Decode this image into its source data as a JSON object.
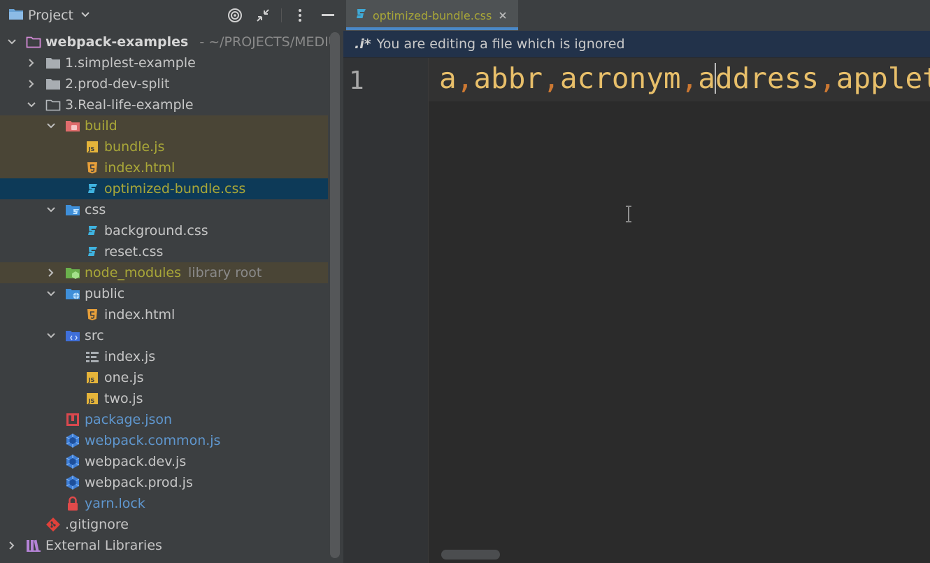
{
  "project_panel": {
    "title": "Project",
    "toolbar_icons": [
      "locate-icon",
      "collapse-icon",
      "more-icon",
      "hide-icon"
    ]
  },
  "tree": [
    {
      "label": "webpack-examples",
      "hint": "- ~/PROJECTS/MEDIU",
      "icon": "module-folder-icon",
      "expanded": true,
      "style": "bold"
    },
    {
      "label": "1.simplest-example",
      "icon": "folder-icon",
      "expanded": false,
      "style": "default"
    },
    {
      "label": "2.prod-dev-split",
      "icon": "folder-icon",
      "expanded": false,
      "style": "default"
    },
    {
      "label": "3.Real-life-example",
      "icon": "folder-open-icon",
      "expanded": true,
      "style": "default"
    },
    {
      "label": "build",
      "icon": "excluded-folder-icon",
      "expanded": true,
      "style": "olive",
      "bg": "excluded"
    },
    {
      "label": "bundle.js",
      "icon": "js-file-icon",
      "style": "olive",
      "bg": "excluded"
    },
    {
      "label": "index.html",
      "icon": "html-file-icon",
      "style": "olive",
      "bg": "excluded"
    },
    {
      "label": "optimized-bundle.css",
      "icon": "css-file-icon",
      "style": "olive",
      "bg": "selected"
    },
    {
      "label": "css",
      "icon": "css-folder-icon",
      "expanded": true,
      "style": "default"
    },
    {
      "label": "background.css",
      "icon": "css-file-icon",
      "style": "default"
    },
    {
      "label": "reset.css",
      "icon": "css-file-icon",
      "style": "default"
    },
    {
      "label": "node_modules",
      "extra": "library root",
      "icon": "node-modules-icon",
      "expanded": false,
      "style": "olive",
      "bg": "excluded"
    },
    {
      "label": "public",
      "icon": "web-folder-icon",
      "expanded": true,
      "style": "default"
    },
    {
      "label": "index.html",
      "icon": "html-file-icon",
      "style": "default"
    },
    {
      "label": "src",
      "icon": "source-folder-icon",
      "expanded": true,
      "style": "default"
    },
    {
      "label": "index.js",
      "icon": "structure-file-icon",
      "style": "default"
    },
    {
      "label": "one.js",
      "icon": "js-file-icon",
      "style": "default"
    },
    {
      "label": "two.js",
      "icon": "js-file-icon",
      "style": "default"
    },
    {
      "label": "package.json",
      "icon": "npm-icon",
      "style": "blue"
    },
    {
      "label": "webpack.common.js",
      "icon": "webpack-icon",
      "style": "blue"
    },
    {
      "label": "webpack.dev.js",
      "icon": "webpack-icon",
      "style": "default"
    },
    {
      "label": "webpack.prod.js",
      "icon": "webpack-icon",
      "style": "default"
    },
    {
      "label": "yarn.lock",
      "icon": "lock-icon",
      "style": "blue"
    },
    {
      "label": ".gitignore",
      "icon": "git-icon",
      "style": "default"
    },
    {
      "label": "External Libraries",
      "icon": "libraries-icon",
      "expanded": false,
      "style": "default"
    }
  ],
  "editor": {
    "tab_label": "optimized-bundle.css",
    "banner_icon": ".i*",
    "banner_text": "You are editing a file which is ignored",
    "line_number": "1",
    "code_tokens": [
      "a",
      ",",
      "abbr",
      ",",
      "acronym",
      ",",
      "a",
      "ddress",
      ",",
      "applet"
    ]
  },
  "colors": {
    "panel_bg": "#3c3f41",
    "editor_bg": "#2b2b2b",
    "selection": "#0d3a58",
    "excluded_bg": "#4a4536",
    "olive_text": "#a9a738",
    "blue_text": "#5f97cf",
    "css_token": "#e8bf6a",
    "accent": "#4a88c7"
  }
}
